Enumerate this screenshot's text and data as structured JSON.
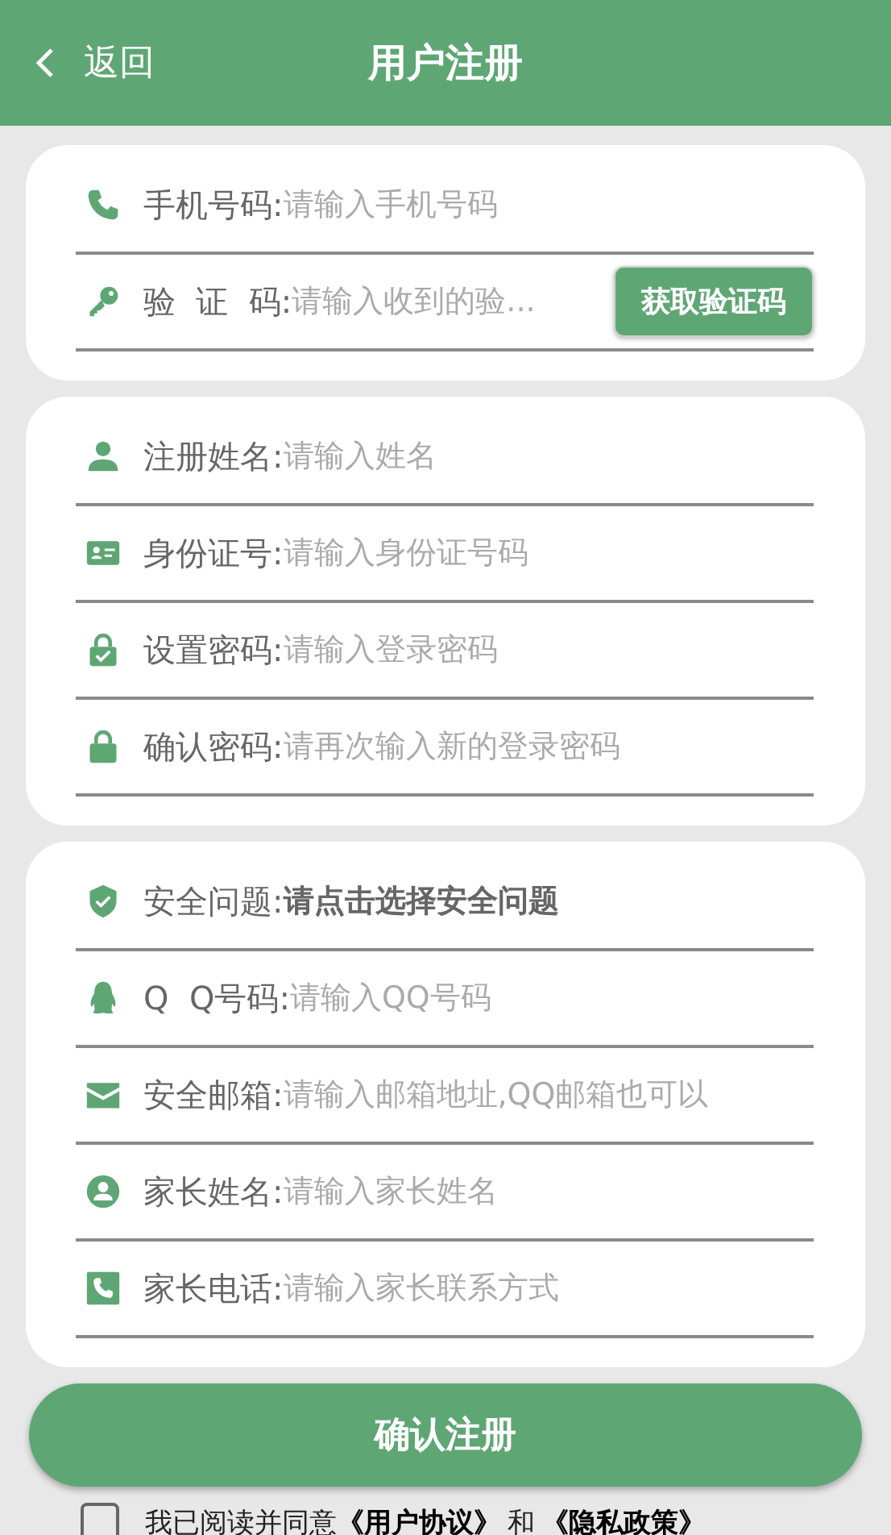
{
  "header": {
    "back": "返回",
    "title": "用户注册"
  },
  "sections": [
    {
      "rows": [
        {
          "kind": "input",
          "label": "手机号码:",
          "placeholder": "请输入手机号码"
        },
        {
          "kind": "code",
          "label": "验  证  码:",
          "placeholder": "请输入收到的验...",
          "button": "获取验证码"
        }
      ]
    },
    {
      "rows": [
        {
          "kind": "input",
          "label": "注册姓名:",
          "placeholder": "请输入姓名"
        },
        {
          "kind": "input",
          "label": "身份证号:",
          "placeholder": "请输入身份证号码"
        },
        {
          "kind": "input",
          "label": "设置密码:",
          "placeholder": "请输入登录密码"
        },
        {
          "kind": "input",
          "label": "确认密码:",
          "placeholder": "请再次输入新的登录密码"
        }
      ]
    },
    {
      "rows": [
        {
          "kind": "select",
          "label": "安全问题:",
          "value": "请点击选择安全问题"
        },
        {
          "kind": "input",
          "label": "Q  Q号码:",
          "placeholder": "请输入QQ号码"
        },
        {
          "kind": "input",
          "label": "安全邮箱:",
          "placeholder": "请输入邮箱地址,QQ邮箱也可以"
        },
        {
          "kind": "input",
          "label": "家长姓名:",
          "placeholder": "请输入家长姓名"
        },
        {
          "kind": "input",
          "label": "家长电话:",
          "placeholder": "请输入家长联系方式"
        }
      ]
    }
  ],
  "submit": "确认注册",
  "agreement": {
    "checked": false,
    "text": "我已阅读并同意",
    "links": [
      "《用户协议》",
      "《隐私政策》"
    ],
    "joiner": "和"
  }
}
